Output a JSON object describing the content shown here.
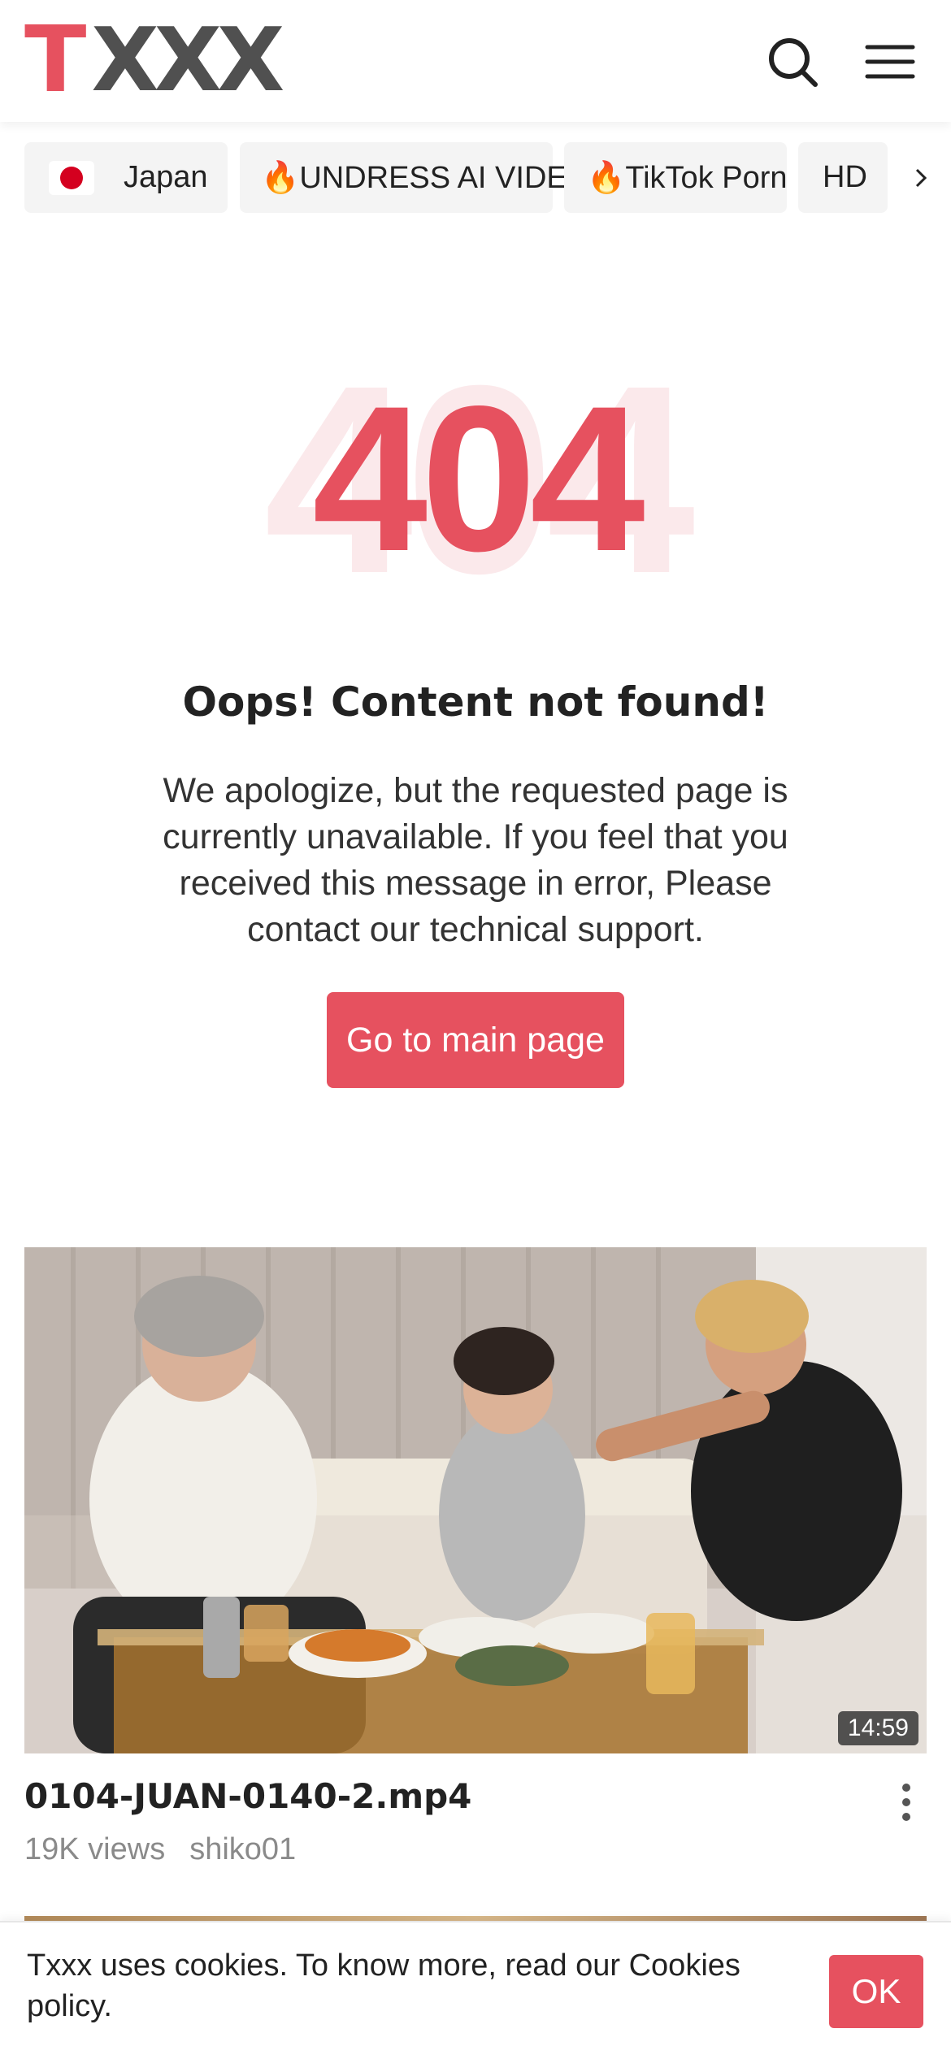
{
  "header": {
    "logo_t": "T",
    "logo_x": "XXX",
    "search_icon": "search-icon",
    "menu_icon": "hamburger-menu-icon"
  },
  "chips": [
    {
      "label": "Japan",
      "flag": "japan-flag-icon"
    },
    {
      "label": "🔥UNDRESS AI VIDEO"
    },
    {
      "label": "🔥TikTok Porn"
    },
    {
      "label": "HD"
    }
  ],
  "chips_next_icon": "chevron-right-icon",
  "error": {
    "code": "404",
    "heading": "Oops! Content not found!",
    "message": "We apologize, but the requested page is currently unavailable. If you feel that you received this message in error, Please contact our technical support.",
    "button": "Go to main page"
  },
  "video": {
    "duration": "14:59",
    "title": "0104-JUAN-0140-2.mp4",
    "views": "19K views",
    "uploader": "shiko01",
    "more_icon": "more-vertical-icon"
  },
  "cookie": {
    "text": "Txxx uses cookies. To know more, read our Cookies policy.",
    "ok": "OK"
  },
  "colors": {
    "accent": "#e6515f",
    "logo_gray": "#505050"
  }
}
